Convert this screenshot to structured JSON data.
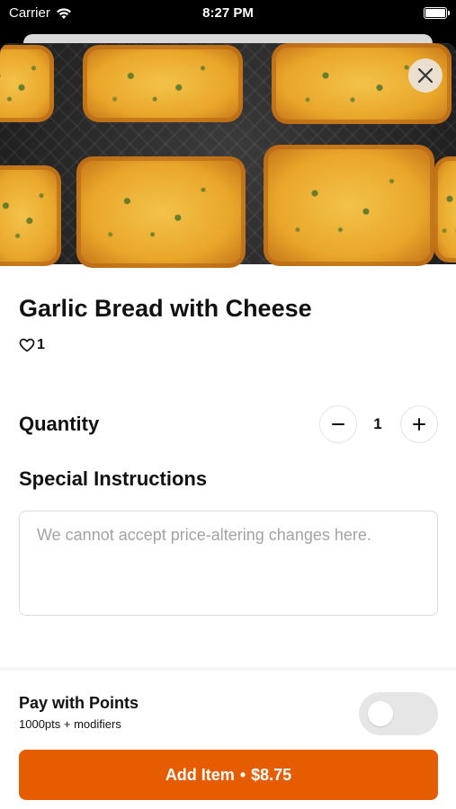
{
  "status_bar": {
    "carrier": "Carrier",
    "time": "8:27 PM",
    "wifi_icon": "wifi-icon",
    "battery_icon": "battery-icon"
  },
  "item": {
    "image_description_icon": "garlic-bread-photo",
    "title": "Garlic Bread with Cheese",
    "likes": "1",
    "heart_icon": "heart-outline-icon",
    "close_icon": "close-icon"
  },
  "quantity": {
    "label": "Quantity",
    "value": "1",
    "minus_label": "−",
    "plus_label": "+"
  },
  "special_instructions": {
    "label": "Special Instructions",
    "placeholder": "We cannot accept price-altering changes here.",
    "value": ""
  },
  "points": {
    "title": "Pay with Points",
    "subtitle": "1000pts + modifiers",
    "enabled": false
  },
  "add_button": {
    "label": "Add Item",
    "separator": "•",
    "price": "$8.75"
  },
  "colors": {
    "accent": "#e65c00",
    "text": "#111111",
    "placeholder": "#a3a3a3",
    "toggle_off": "#e6e6e6"
  }
}
